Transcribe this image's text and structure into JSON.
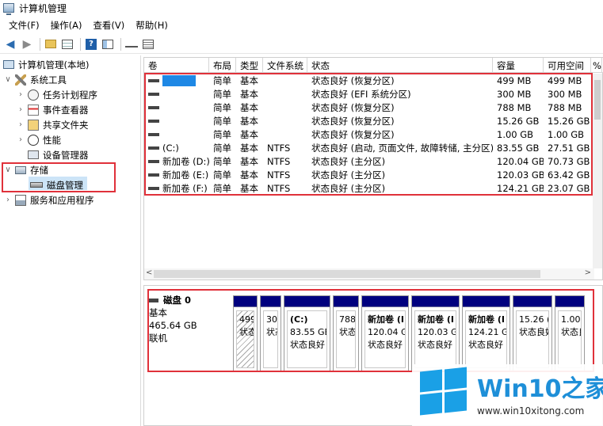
{
  "window": {
    "title": "计算机管理"
  },
  "menu": [
    "文件(F)",
    "操作(A)",
    "查看(V)",
    "帮助(H)"
  ],
  "toolbar_icons": [
    "back-arrow-icon",
    "forward-arrow-icon",
    "folder-up-icon",
    "show-hide-tree-icon",
    "help-icon",
    "properties-pane-icon",
    "key-icon",
    "list-view-icon"
  ],
  "tree": {
    "root": "计算机管理(本地)",
    "system_tools": "系统工具",
    "task_scheduler": "任务计划程序",
    "event_viewer": "事件查看器",
    "shared_folders": "共享文件夹",
    "performance": "性能",
    "device_manager": "设备管理器",
    "storage": "存储",
    "disk_management": "磁盘管理",
    "services_apps": "服务和应用程序"
  },
  "volume_table": {
    "columns": [
      "卷",
      "布局",
      "类型",
      "文件系统",
      "状态",
      "容量",
      "可用空间",
      "%"
    ],
    "rows": [
      {
        "vol": "",
        "layout": "简单",
        "type": "基本",
        "fs": "",
        "status": "状态良好 (恢复分区)",
        "cap": "499 MB",
        "free": "499 MB"
      },
      {
        "vol": "",
        "layout": "简单",
        "type": "基本",
        "fs": "",
        "status": "状态良好 (EFI 系统分区)",
        "cap": "300 MB",
        "free": "300 MB"
      },
      {
        "vol": "",
        "layout": "简单",
        "type": "基本",
        "fs": "",
        "status": "状态良好 (恢复分区)",
        "cap": "788 MB",
        "free": "788 MB"
      },
      {
        "vol": "",
        "layout": "简单",
        "type": "基本",
        "fs": "",
        "status": "状态良好 (恢复分区)",
        "cap": "15.26 GB",
        "free": "15.26 GB"
      },
      {
        "vol": "",
        "layout": "简单",
        "type": "基本",
        "fs": "",
        "status": "状态良好 (恢复分区)",
        "cap": "1.00 GB",
        "free": "1.00 GB"
      },
      {
        "vol": "(C:)",
        "layout": "简单",
        "type": "基本",
        "fs": "NTFS",
        "status": "状态良好 (启动, 页面文件, 故障转储, 主分区)",
        "cap": "83.55 GB",
        "free": "27.51 GB"
      },
      {
        "vol": "新加卷 (D:)",
        "layout": "简单",
        "type": "基本",
        "fs": "NTFS",
        "status": "状态良好 (主分区)",
        "cap": "120.04 GB",
        "free": "70.73 GB"
      },
      {
        "vol": "新加卷 (E:)",
        "layout": "简单",
        "type": "基本",
        "fs": "NTFS",
        "status": "状态良好 (主分区)",
        "cap": "120.03 GB",
        "free": "63.42 GB"
      },
      {
        "vol": "新加卷 (F:)",
        "layout": "简单",
        "type": "基本",
        "fs": "NTFS",
        "status": "状态良好 (主分区)",
        "cap": "124.21 GB",
        "free": "23.07 GB"
      }
    ]
  },
  "disk": {
    "name": "磁盘 0",
    "type": "基本",
    "size": "465.64 GB",
    "state": "联机",
    "partitions": [
      {
        "title": "",
        "size": "499",
        "status": "状态"
      },
      {
        "title": "",
        "size": "30(",
        "status": "状态"
      },
      {
        "title": "(C:)",
        "size": "83.55 GB",
        "status": "状态良好"
      },
      {
        "title": "",
        "size": "788",
        "status": "状态"
      },
      {
        "title": "新加卷 (I",
        "size": "120.04 G",
        "status": "状态良好"
      },
      {
        "title": "新加卷 (I",
        "size": "120.03 G",
        "status": "状态良好"
      },
      {
        "title": "新加卷 (I",
        "size": "124.21 G",
        "status": "状态良好"
      },
      {
        "title": "",
        "size": "15.26 (",
        "status": "状态良好"
      },
      {
        "title": "",
        "size": "1.00",
        "status": "状态良"
      }
    ]
  },
  "watermark": {
    "brand": "Win10之家",
    "url": "www.win10xitong.com"
  },
  "colors": {
    "highlight_box": "#e0313a",
    "partition_bar": "#00007f",
    "selection": "#cce4f7",
    "brand": "#1e8fd8"
  }
}
